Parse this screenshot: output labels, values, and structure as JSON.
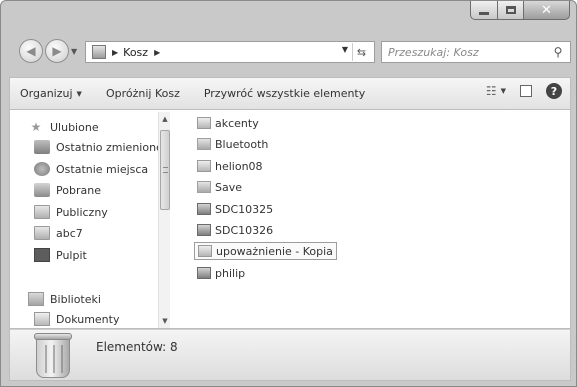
{
  "address": {
    "crumb": "Kosz"
  },
  "search": {
    "placeholder": "Przeszukaj: Kosz"
  },
  "toolbar": {
    "organize": "Organizuj",
    "empty_bin": "Opróżnij Kosz",
    "restore_all": "Przywróć wszystkie elementy"
  },
  "nav": {
    "favorites": "Ulubione",
    "recent_changes": "Ostatnio zmienione",
    "recent_places": "Ostatnie miejsca",
    "downloads": "Pobrane",
    "public": "Publiczny",
    "abc7": "abc7",
    "desktop": "Pulpit",
    "libraries": "Biblioteki",
    "documents": "Dokumenty"
  },
  "files": [
    {
      "name": "akcenty",
      "icon": "file-icon"
    },
    {
      "name": "Bluetooth",
      "icon": "folder-icon"
    },
    {
      "name": "helion08",
      "icon": "file-icon"
    },
    {
      "name": "Save",
      "icon": "folder-icon"
    },
    {
      "name": "SDC10325",
      "icon": "media-icon"
    },
    {
      "name": "SDC10326",
      "icon": "media-icon"
    },
    {
      "name": "upoważnienie - Kopia",
      "icon": "file-icon",
      "selected": true
    },
    {
      "name": "philip",
      "icon": "media-icon"
    }
  ],
  "status": {
    "count_text": "Elementów: 8"
  }
}
